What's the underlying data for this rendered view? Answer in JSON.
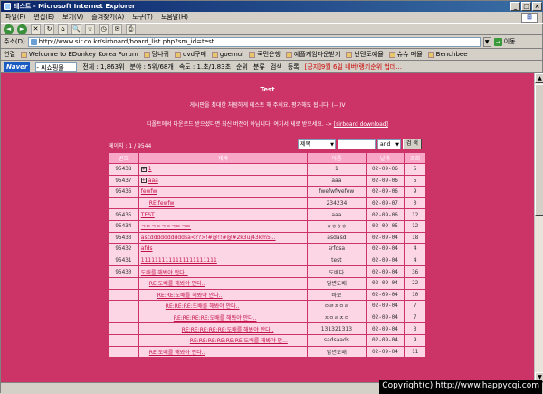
{
  "window": {
    "title": "테스트 - Microsoft Internet Explorer",
    "btn_min": "_",
    "btn_max": "□",
    "btn_close": "×"
  },
  "menu": [
    "파일(F)",
    "편집(E)",
    "보기(V)",
    "즐겨찾기(A)",
    "도구(T)",
    "도움말(H)"
  ],
  "toolbar": {
    "back": "◄",
    "forward": "►",
    "stop": "✕",
    "refresh": "↻",
    "home": "⌂",
    "search": "🔍",
    "favorites": "☆",
    "history": "◷",
    "mail": "✉",
    "print": "⎙"
  },
  "address": {
    "label": "주소(D)",
    "url": "http://www.sir.co.kr/sirboard/board_list.php?sm_id=test",
    "go_label": "이동"
  },
  "links": {
    "label": "연결",
    "items": [
      "Welcome to EDonkey Korea Forum",
      "당나귀",
      "dvd구매",
      "goemul",
      "국민은행",
      "예플게임다운받기",
      "난텐도예뮬",
      "슈슈 매뮬",
      "Benchbee"
    ]
  },
  "navertoolbar": {
    "logo": "Naver",
    "search_text": "- 씨쇼핑몰",
    "stats": "전체 : 1,863위",
    "field2": "분야 : 5위/68개",
    "field3": "속도 : 1.초/1.83초",
    "btn_rank": "순위",
    "btn_category": "분류",
    "btn_search": "검색",
    "btn_register": "등록",
    "notice": "[공지]9월 6일 네버/랭키순위 업데..."
  },
  "page": {
    "title": "Test",
    "note1": "게시판을 최대한 처럼하게 테스트 해 주세요. 평가해도 됩니다. (-- )V",
    "note2_prefix": "디폴트에서 다운로드 받으셨다면 최신 버전이 아닙니다. 여기서 새로 받으세요. -> ",
    "note2_link": "[sirboard download]",
    "page_info": "페이지 : 1 / 9544",
    "search": {
      "field_select": "제목",
      "op_select": "and",
      "button": "검 색"
    }
  },
  "table": {
    "columns": [
      "번호",
      "제목",
      "이름",
      "날짜",
      "조회"
    ],
    "rows": [
      {
        "no": "95438",
        "plus": true,
        "title": "1",
        "name": "1",
        "date": "02-09-06",
        "hits": "5"
      },
      {
        "no": "95437",
        "plus": true,
        "title": "aaa",
        "name": "aaa",
        "date": "02-09-06",
        "hits": "5"
      },
      {
        "no": "95436",
        "plus": false,
        "title": "fewfw",
        "name": "fwefwfwefew",
        "date": "02-09-06",
        "hits": "9"
      },
      {
        "no": "",
        "plus": false,
        "title": "RE:fewfw",
        "name": "234234",
        "date": "02-09-07",
        "hits": "0",
        "indent": 1
      },
      {
        "no": "95435",
        "plus": false,
        "title": "TEST",
        "name": "aaa",
        "date": "02-09-06",
        "hits": "12"
      },
      {
        "no": "95434",
        "plus": false,
        "title": "ㄱㄷㄱㄷㄱㄷㄱㄷㄱㄷ",
        "name": "ㅎㅎㅎㅎ",
        "date": "02-09-05",
        "hits": "12"
      },
      {
        "no": "95433",
        "plus": false,
        "title": "ascddddddddddsa<??>!#@!!#@#2k3uj43km5...",
        "name": "asdasd",
        "date": "02-09-04",
        "hits": "18"
      },
      {
        "no": "95432",
        "plus": false,
        "title": "afds",
        "name": "srfdsa",
        "date": "02-09-04",
        "hits": "4"
      },
      {
        "no": "95431",
        "plus": false,
        "title": "1111111111111111111111",
        "name": "test",
        "date": "02-09-04",
        "hits": "4"
      },
      {
        "no": "95430",
        "plus": false,
        "title": "도배를 해봐야 안다..",
        "name": "도배다",
        "date": "02-09-04",
        "hits": "36"
      },
      {
        "no": "",
        "plus": false,
        "title": "RE:도배를 해봐야 안다..",
        "name": "답변도배",
        "date": "02-09-04",
        "hits": "22",
        "indent": 1
      },
      {
        "no": "",
        "plus": false,
        "title": "RE:RE:도배를 해봐야 안다..",
        "name": "바보",
        "date": "02-09-04",
        "hits": "10",
        "indent": 2
      },
      {
        "no": "",
        "plus": false,
        "title": "RE:RE:RE:도배를 해봐야 안다..",
        "name": "ㅇㄹㅈㅇㄹ",
        "date": "02-09-04",
        "hits": "7",
        "indent": 3
      },
      {
        "no": "",
        "plus": false,
        "title": "RE:RE:RE:RE:도배를 해봐야 안다..",
        "name": "ㅈㅇㄹㅈㅇ",
        "date": "02-09-04",
        "hits": "7",
        "indent": 4
      },
      {
        "no": "",
        "plus": false,
        "title": "RE:RE:RE:RE:RE:도배를 해봐야 안다..",
        "name": "131321313",
        "date": "02-09-04",
        "hits": "3",
        "indent": 5
      },
      {
        "no": "",
        "plus": false,
        "title": "RE:RE:RE:RE:RE:RE:도배를 해봐야 안...",
        "name": "sadsaads",
        "date": "02-09-04",
        "hits": "9",
        "indent": 6
      },
      {
        "no": "",
        "plus": false,
        "title": "RE:도배를 해봐야 안다..",
        "name": "답변도배",
        "date": "02-09-04",
        "hits": "11",
        "indent": 1
      }
    ]
  },
  "copyright": "Copyright(c) http://www.happycgi.com",
  "colors": {
    "page_bg": "#cc3366",
    "header_cell": "#f9a7c6",
    "row_cell": "#fcd6e4",
    "link": "#c3124a"
  }
}
